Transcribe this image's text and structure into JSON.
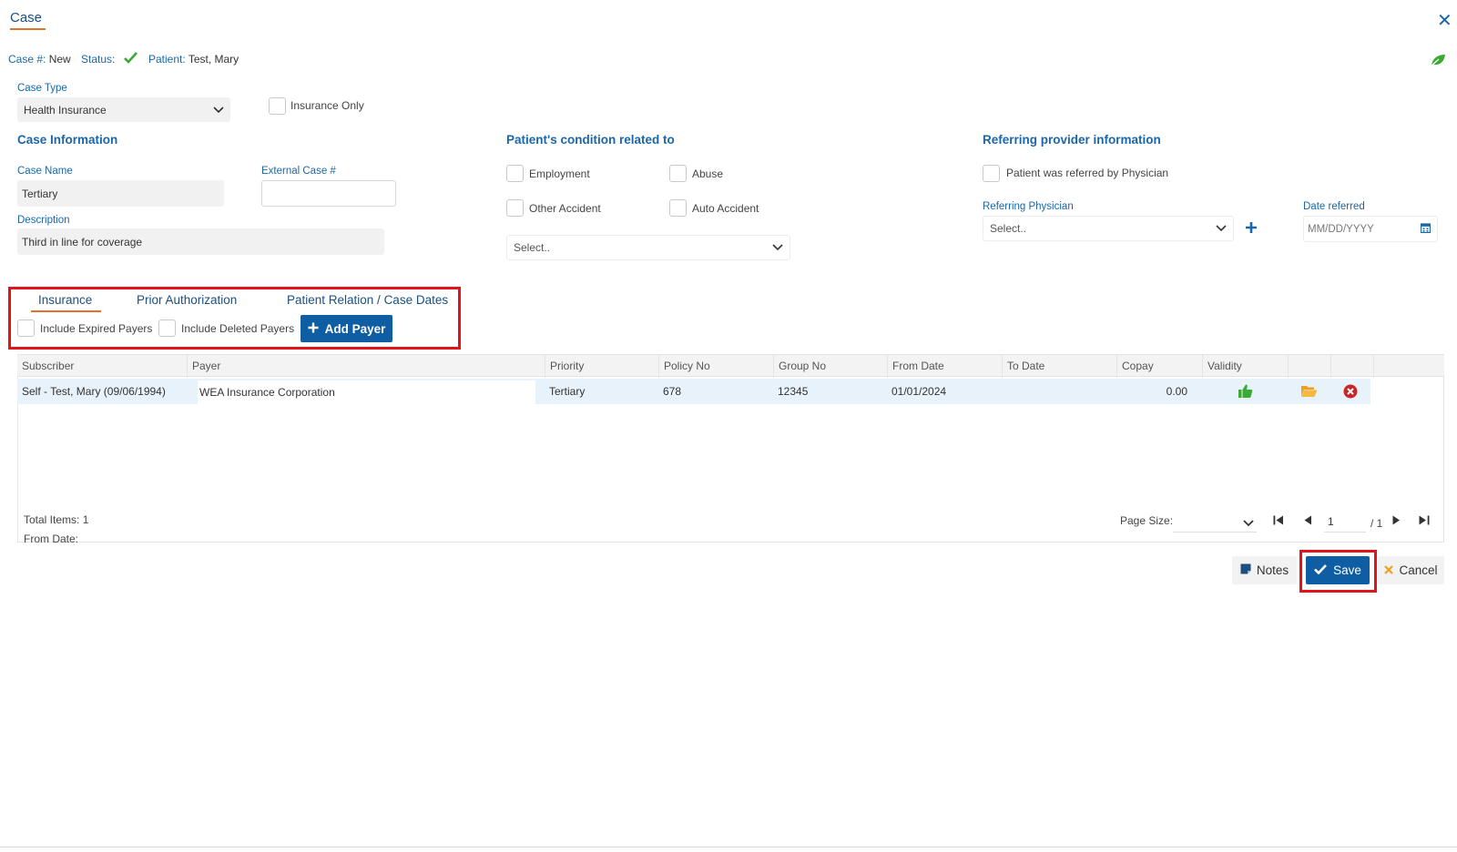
{
  "header": {
    "title": "Case",
    "close_icon": "✕"
  },
  "meta": {
    "case_no_label": "Case #:",
    "case_no_value": "New",
    "status_label": "Status:",
    "patient_label": "Patient:",
    "patient_value": "Test, Mary"
  },
  "case_type": {
    "label": "Case Type",
    "value": "Health Insurance"
  },
  "insurance_only": {
    "label": "Insurance Only",
    "checked": false
  },
  "case_info": {
    "title": "Case Information",
    "case_name_label": "Case Name",
    "case_name_value": "Tertiary",
    "external_case_label": "External Case #",
    "external_case_value": "",
    "description_label": "Description",
    "description_value": "Third in line for coverage"
  },
  "condition": {
    "title": "Patient's condition related to",
    "employment": "Employment",
    "abuse": "Abuse",
    "other_accident": "Other Accident",
    "auto_accident": "Auto Accident",
    "select_placeholder": "Select.."
  },
  "referring": {
    "title": "Referring provider information",
    "referred_by_physician": "Patient was referred by Physician",
    "physician_label": "Referring Physician",
    "physician_placeholder": "Select..",
    "date_label": "Date referred",
    "date_placeholder": "MM/DD/YYYY"
  },
  "tabs": {
    "insurance": "Insurance",
    "prior_auth": "Prior Authorization",
    "relation": "Patient Relation / Case Dates"
  },
  "filters": {
    "include_expired": "Include Expired Payers",
    "include_deleted": "Include Deleted Payers",
    "add_payer": "Add Payer"
  },
  "grid": {
    "columns": [
      "Subscriber",
      "Payer",
      "Priority",
      "Policy No",
      "Group No",
      "From Date",
      "To Date",
      "Copay",
      "Validity"
    ],
    "rows": [
      {
        "subscriber": "Self - Test, Mary (09/06/1994)",
        "payer": "WEA Insurance Corporation",
        "priority": "Tertiary",
        "policy_no": "678",
        "group_no": "12345",
        "from_date": "01/01/2024",
        "to_date": "",
        "copay": "0.00"
      }
    ],
    "total_items": "Total Items: 1",
    "from_date": "From Date:",
    "page_size_label": "Page Size:",
    "page_value": "1",
    "page_total": "/ 1"
  },
  "actions": {
    "notes": "Notes",
    "save": "Save",
    "cancel": "Cancel"
  },
  "colors": {
    "accent": "#1b66a8",
    "primary_button": "#0f5ea4",
    "highlight_box": "#e1141b",
    "tab_underline": "#e8702a",
    "success": "#3aaa35",
    "folder": "#f0a020",
    "delete": "#c62828"
  }
}
